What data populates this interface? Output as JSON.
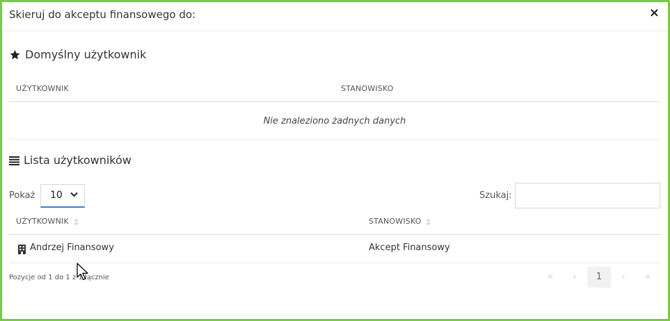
{
  "modal": {
    "title": "Skieruj do akceptu finansowego do:",
    "close": "×"
  },
  "default_user": {
    "heading": "Domyślny użytkownik",
    "columns": [
      "UŻYTKOWNIK",
      "STANOWISKO"
    ],
    "empty_message": "Nie znaleziono żadnych danych"
  },
  "user_list": {
    "heading": "Lista użytkowników",
    "show_label": "Pokaż",
    "page_size": "10",
    "search_label": "Szukaj:",
    "search_value": "",
    "columns": [
      "UŻYTKOWNIK",
      "STANOWISKO"
    ],
    "rows": [
      {
        "name": "Andrzej Finansowy",
        "position": "Akcept Finansowy"
      }
    ],
    "info": "Pozycje od 1 do 1 z 1 łącznie",
    "pagination": {
      "first": "«",
      "prev": "‹",
      "current": "1",
      "next": "›",
      "last": "»"
    }
  },
  "colors": {
    "frame_border": "#7ac943",
    "select_accent": "#3a7bd5"
  }
}
